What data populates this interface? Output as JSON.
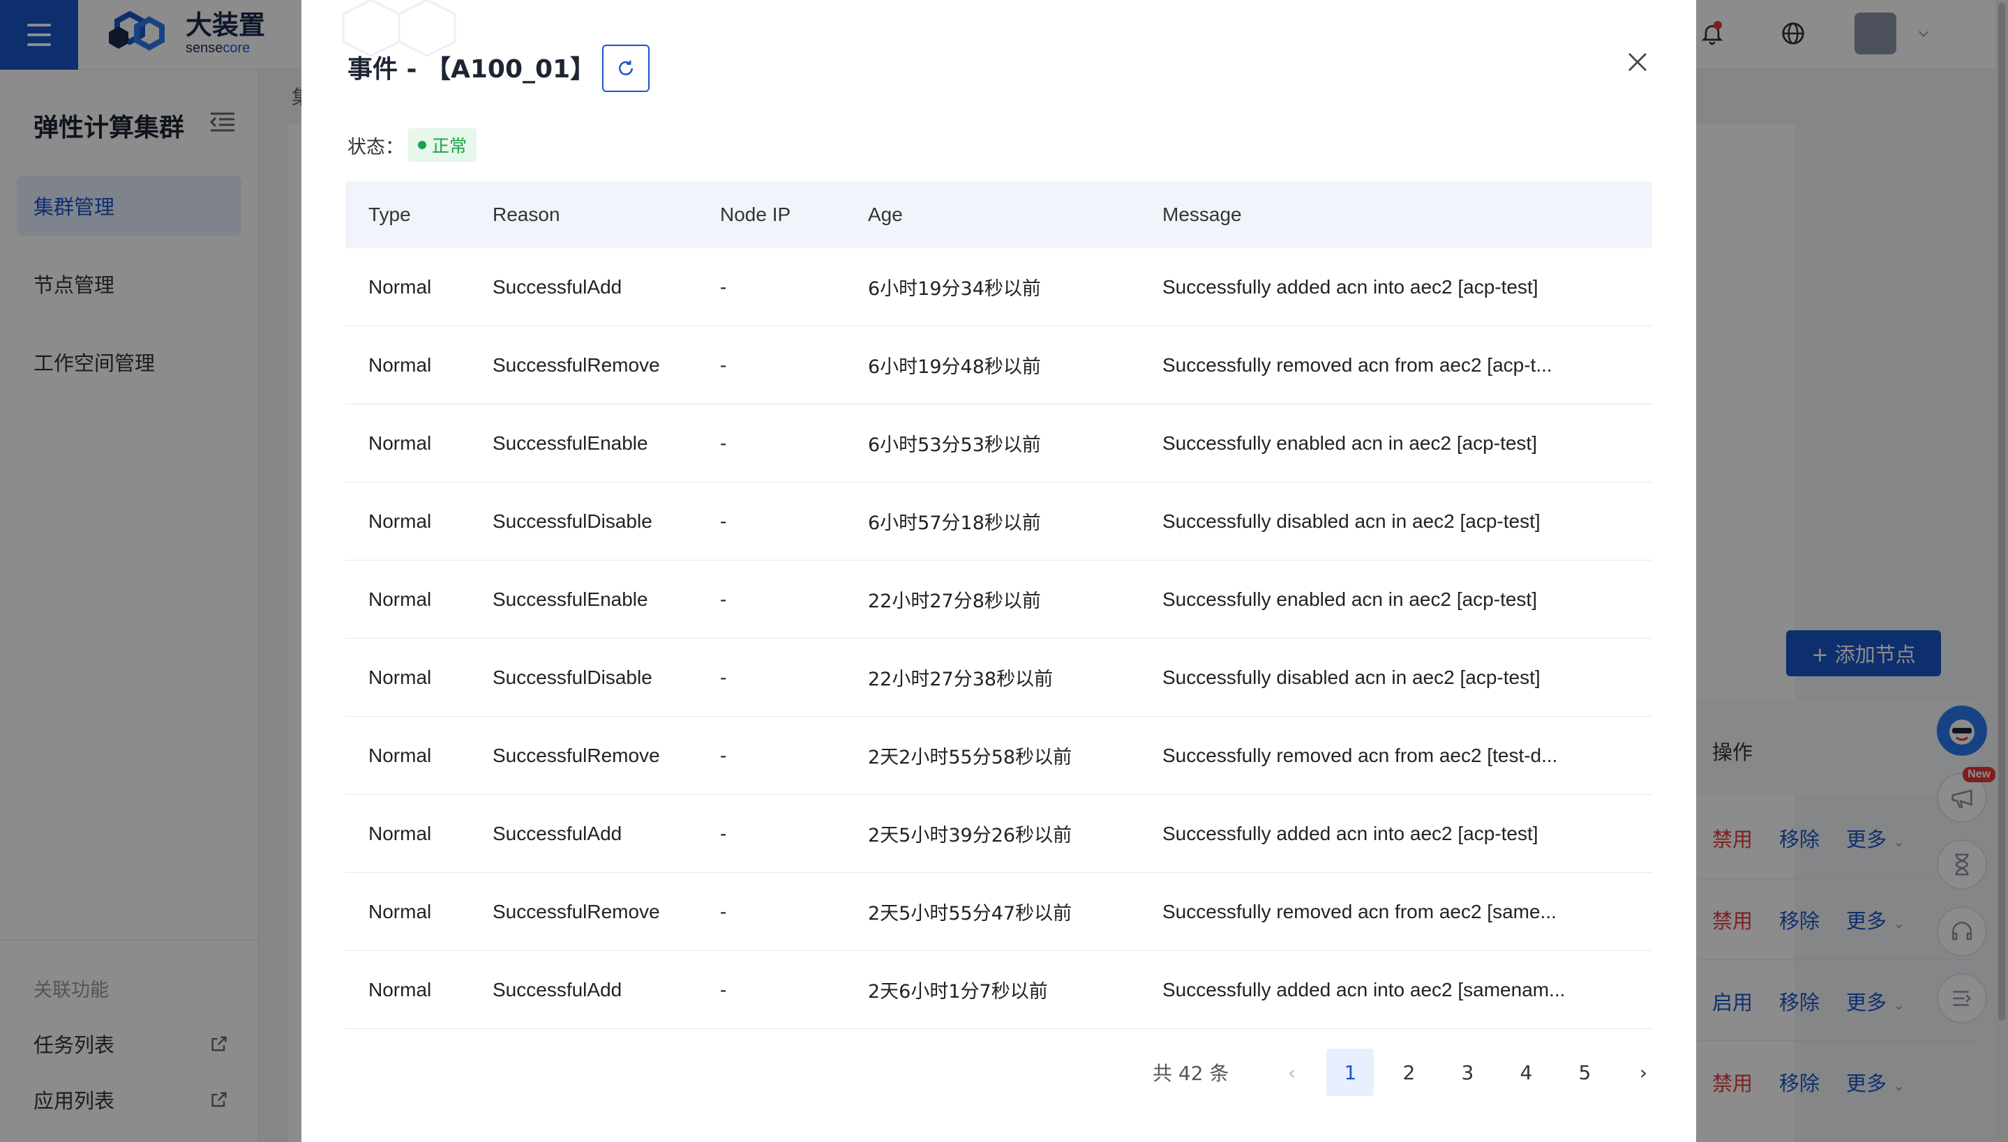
{
  "app": {
    "logo_cn": "大装置",
    "logo_en_a": "sense",
    "logo_en_b": "core"
  },
  "sidebar": {
    "title": "弹性计算集群",
    "items": [
      {
        "label": "集群管理"
      },
      {
        "label": "节点管理"
      },
      {
        "label": "工作空间管理"
      }
    ],
    "section_label": "关联功能",
    "links": [
      {
        "label": "任务列表"
      },
      {
        "label": "应用列表"
      }
    ]
  },
  "background": {
    "crumb": "集",
    "add_node_label": "+ 添加节点",
    "ops_header": "操作",
    "ops_rows": [
      {
        "toggle": "禁用",
        "remove": "移除",
        "more": "更多"
      },
      {
        "toggle": "禁用",
        "remove": "移除",
        "more": "更多"
      },
      {
        "toggle": "启用",
        "remove": "移除",
        "more": "更多"
      },
      {
        "toggle": "禁用",
        "remove": "移除",
        "more": "更多"
      }
    ],
    "new_badge": "New"
  },
  "modal": {
    "title": "事件 - 【A100_01】",
    "status_label": "状态：",
    "status_value": "正常",
    "columns": [
      "Type",
      "Reason",
      "Node IP",
      "Age",
      "Message"
    ],
    "rows": [
      {
        "type": "Normal",
        "reason": "SuccessfulAdd",
        "node_ip": "-",
        "age": "6小时19分34秒以前",
        "message": "Successfully added acn into aec2 [acp-test]"
      },
      {
        "type": "Normal",
        "reason": "SuccessfulRemove",
        "node_ip": "-",
        "age": "6小时19分48秒以前",
        "message": "Successfully removed acn from aec2 [acp-t..."
      },
      {
        "type": "Normal",
        "reason": "SuccessfulEnable",
        "node_ip": "-",
        "age": "6小时53分53秒以前",
        "message": "Successfully enabled acn in aec2 [acp-test]"
      },
      {
        "type": "Normal",
        "reason": "SuccessfulDisable",
        "node_ip": "-",
        "age": "6小时57分18秒以前",
        "message": "Successfully disabled acn in aec2 [acp-test]"
      },
      {
        "type": "Normal",
        "reason": "SuccessfulEnable",
        "node_ip": "-",
        "age": "22小时27分8秒以前",
        "message": "Successfully enabled acn in aec2 [acp-test]"
      },
      {
        "type": "Normal",
        "reason": "SuccessfulDisable",
        "node_ip": "-",
        "age": "22小时27分38秒以前",
        "message": "Successfully disabled acn in aec2 [acp-test]"
      },
      {
        "type": "Normal",
        "reason": "SuccessfulRemove",
        "node_ip": "-",
        "age": "2天2小时55分58秒以前",
        "message": "Successfully removed acn from aec2 [test-d..."
      },
      {
        "type": "Normal",
        "reason": "SuccessfulAdd",
        "node_ip": "-",
        "age": "2天5小时39分26秒以前",
        "message": "Successfully added acn into aec2 [acp-test]"
      },
      {
        "type": "Normal",
        "reason": "SuccessfulRemove",
        "node_ip": "-",
        "age": "2天5小时55分47秒以前",
        "message": "Successfully removed acn from aec2 [same..."
      },
      {
        "type": "Normal",
        "reason": "SuccessfulAdd",
        "node_ip": "-",
        "age": "2天6小时1分7秒以前",
        "message": "Successfully added acn into aec2 [samenam..."
      }
    ],
    "pagination": {
      "total": "共 42 条",
      "pages": [
        "1",
        "2",
        "3",
        "4",
        "5"
      ],
      "current": "1",
      "prev": "‹",
      "next": "›"
    }
  },
  "colors": {
    "primary": "#1a56c8",
    "danger": "#e63a3a",
    "success": "#1aa34a"
  }
}
